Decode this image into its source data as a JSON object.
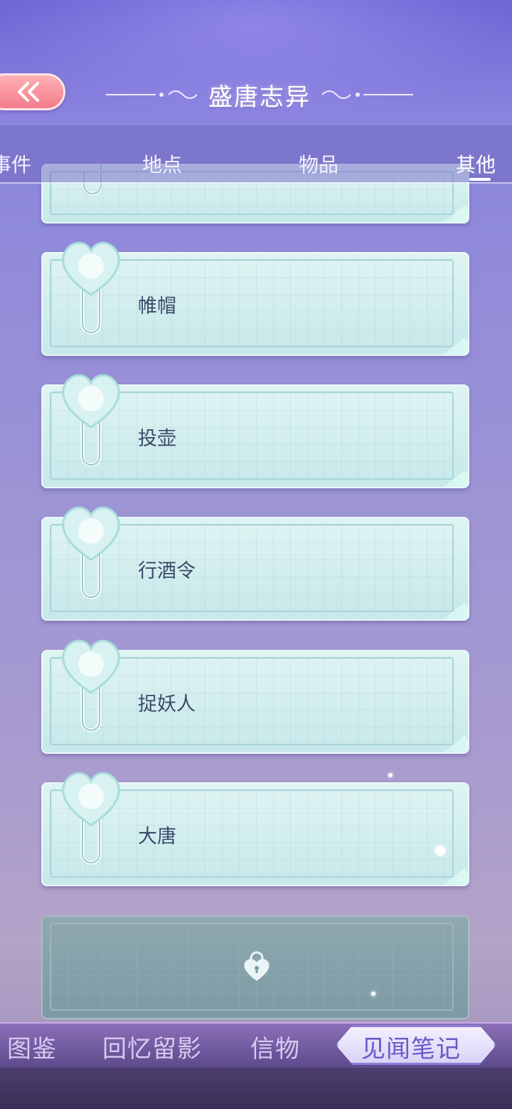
{
  "header": {
    "title": "盛唐志异",
    "back_icon": "double-chevron-left-icon"
  },
  "tabs": [
    {
      "label": "事件",
      "active": false
    },
    {
      "label": "地点",
      "active": false
    },
    {
      "label": "物品",
      "active": false
    },
    {
      "label": "其他",
      "active": true
    }
  ],
  "entries": [
    {
      "label": ""
    },
    {
      "label": "帷帽"
    },
    {
      "label": "投壶"
    },
    {
      "label": "行酒令"
    },
    {
      "label": "捉妖人"
    },
    {
      "label": "大唐"
    }
  ],
  "locked_entry": {
    "icon": "heart-lock-icon"
  },
  "bottom_nav": [
    {
      "label": "图鉴",
      "active": false
    },
    {
      "label": "回忆留影",
      "active": false
    },
    {
      "label": "信物",
      "active": false
    },
    {
      "label": "见闻笔记",
      "active": true
    }
  ],
  "colors": {
    "accent": "#6a5ac8",
    "back_button": "#f27b8a",
    "card": "#d6efef"
  }
}
